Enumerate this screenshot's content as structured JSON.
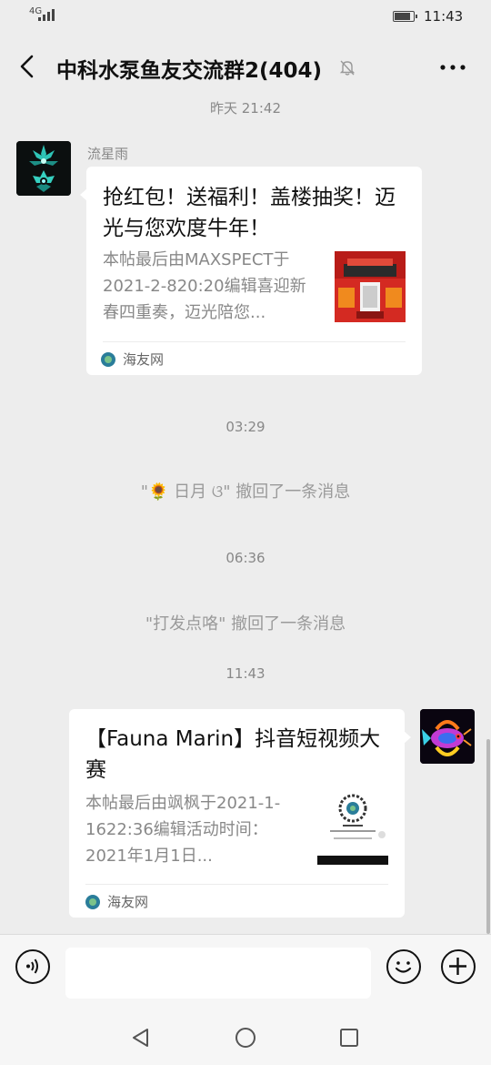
{
  "status_bar": {
    "network": "4G",
    "time": "11:43"
  },
  "header": {
    "title": "中科水泵鱼友交流群2(404)"
  },
  "messages": {
    "time1": "昨天 21:42",
    "sender1": "流星雨",
    "card1": {
      "title": "抢红包！送福利！盖楼抽奖！迈光与您欢度牛年！",
      "desc": "本帖最后由MAXSPECT于2021-2-820:20编辑喜迎新春四重奏，迈光陪您...",
      "source": "海友网"
    },
    "time2": "03:29",
    "recall1": "\"🌻        日月 ଓ\" 撤回了一条消息",
    "time3": "06:36",
    "recall2": "\"打发点咯\" 撤回了一条消息",
    "time4": "11:43",
    "card2": {
      "title": "【Fauna Marin】抖音短视频大赛",
      "desc": "本帖最后由飒枫于2021-1-1622:36编辑活动时间：2021年1月1日...",
      "source": "海友网"
    }
  }
}
